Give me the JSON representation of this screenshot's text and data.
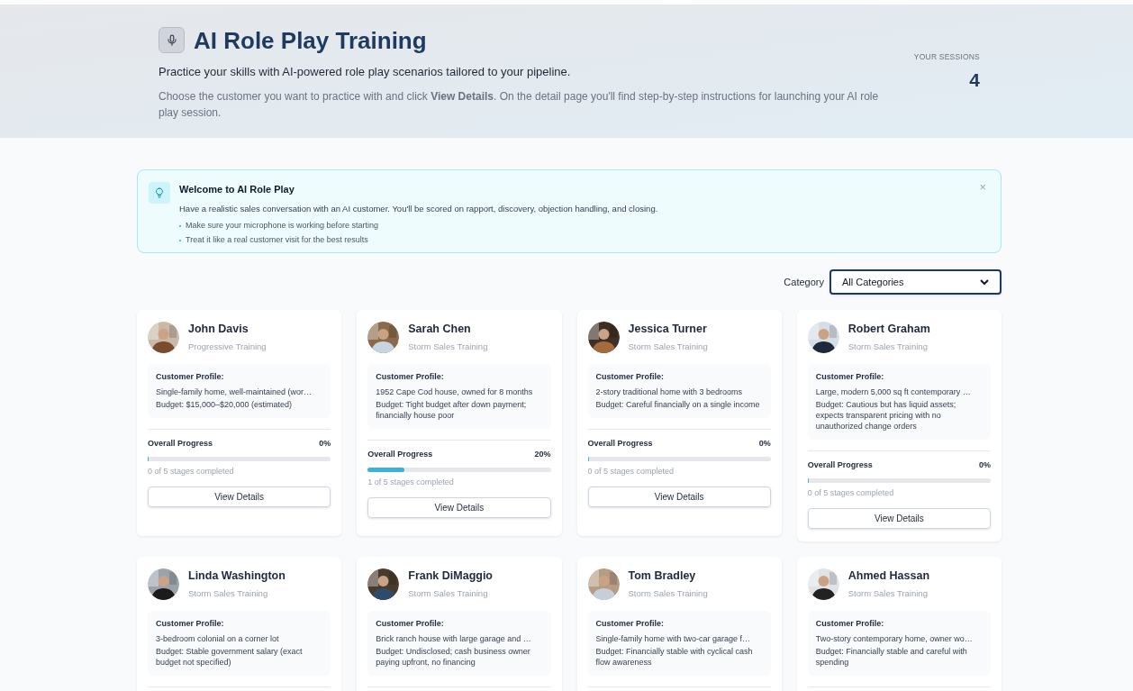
{
  "header": {
    "title": "AI Role Play Training",
    "subtitle": "Practice your skills with AI-powered role play scenarios tailored to your pipeline.",
    "instructions": "Choose the customer you want to practice with and click **View Details**. On the detail page you'll find step-by-step instructions for launching your AI role play session.",
    "sessions_label": "YOUR SESSIONS",
    "sessions_count": "4"
  },
  "welcome": {
    "title": "Welcome to AI Role Play",
    "text": "Have a realistic sales conversation with an AI customer. You'll be scored on rapport, discovery, objection handling, and closing.",
    "tips": [
      "Make sure your microphone is working before starting",
      "Treat it like a real customer visit for the best results"
    ],
    "close": "×"
  },
  "filter": {
    "label": "Category",
    "value": "All Categories"
  },
  "customers": [
    {
      "name": "John Davis",
      "program": "Progressive Training",
      "profile_label": "Customer Profile:",
      "home": "Single-family home, well-maintained (wor…",
      "budget": "Budget: $15,000–$20,000 (estimated)",
      "progress": {
        "label": "Overall Progress",
        "percent": "0%",
        "level": 0,
        "stages": "0 of 5 stages completed"
      },
      "button": "View Details"
    },
    {
      "name": "Sarah Chen",
      "program": "Storm Sales Training",
      "profile_label": "Customer Profile:",
      "home": "1952 Cape Cod house, owned for 8 months",
      "budget": "Budget: Tight budget after down payment; financially house poor",
      "progress": {
        "label": "Overall Progress",
        "percent": "20%",
        "level": 0.2,
        "stages": "1 of 5 stages completed"
      },
      "button": "View Details"
    },
    {
      "name": "Jessica Turner",
      "program": "Storm Sales Training",
      "profile_label": "Customer Profile:",
      "home": "2-story traditional home with 3 bedrooms",
      "budget": "Budget: Careful financially on a single income",
      "progress": {
        "label": "Overall Progress",
        "percent": "0%",
        "level": 0,
        "stages": "0 of 5 stages completed"
      },
      "button": "View Details"
    },
    {
      "name": "Robert Graham",
      "program": "Storm Sales Training",
      "profile_label": "Customer Profile:",
      "home": "Large, modern 5,000 sq ft contemporary …",
      "budget": "Budget: Cautious but has liquid assets; expects transparent pricing with no unauthorized change orders",
      "progress": {
        "label": "Overall Progress",
        "percent": "0%",
        "level": 0,
        "stages": "0 of 5 stages completed"
      },
      "button": "View Details"
    },
    {
      "name": "Linda Washington",
      "program": "Storm Sales Training",
      "profile_label": "Customer Profile:",
      "home": "3-bedroom colonial on a corner lot",
      "budget": "Budget: Stable government salary (exact budget not specified)"
    },
    {
      "name": "Frank DiMaggio",
      "program": "Storm Sales Training",
      "profile_label": "Customer Profile:",
      "home": "Brick ranch house with large garage and …",
      "budget": "Budget: Undisclosed; cash business owner paying upfront, no financing"
    },
    {
      "name": "Tom Bradley",
      "program": "Storm Sales Training",
      "profile_label": "Customer Profile:",
      "home": "Single-family home with two-car garage f…",
      "budget": "Budget: Financially stable with cyclical cash flow awareness"
    },
    {
      "name": "Ahmed Hassan",
      "program": "Storm Sales Training",
      "profile_label": "Customer Profile:",
      "home": "Two-story contemporary home, owner wo…",
      "budget": "Budget: Financially stable and careful with spending"
    }
  ]
}
